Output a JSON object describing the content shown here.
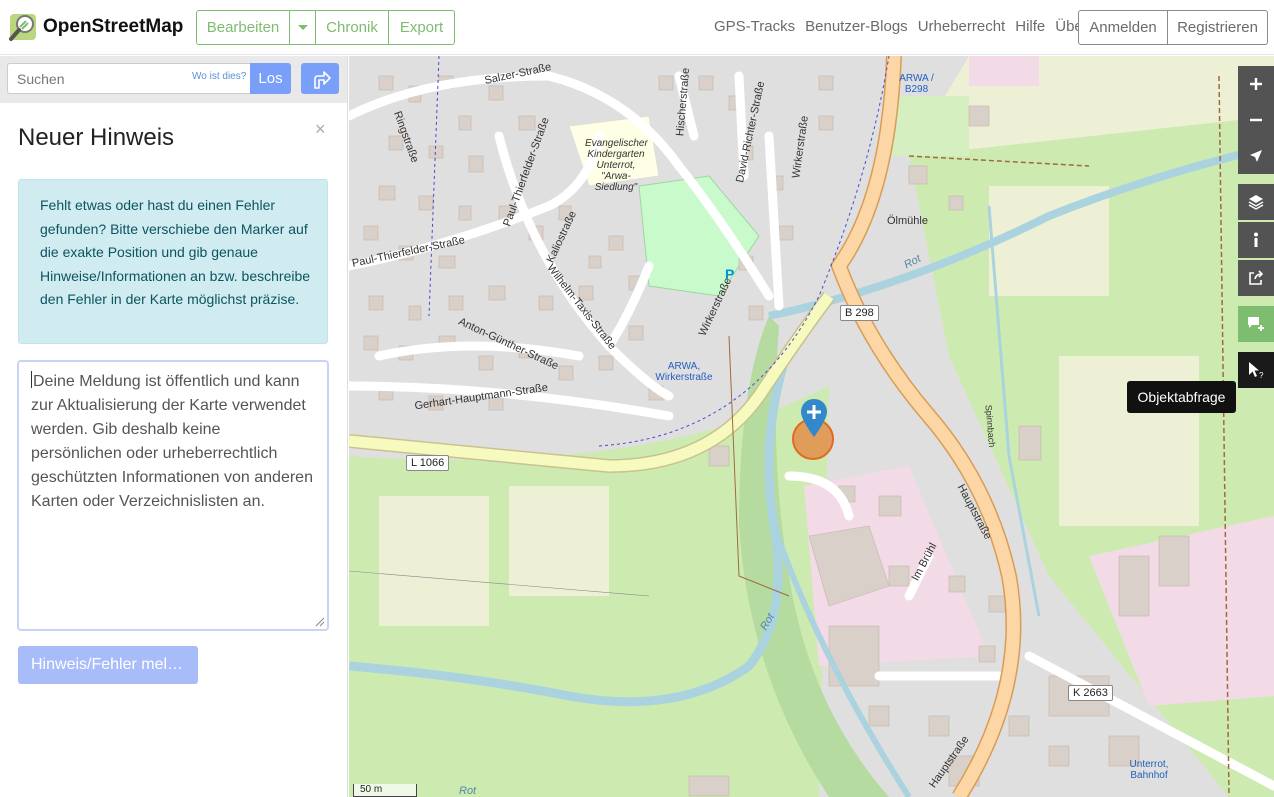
{
  "header": {
    "logo_text": "OpenStreetMap",
    "edit_label": "Bearbeiten",
    "history_label": "Chronik",
    "export_label": "Export",
    "nav": [
      "GPS-Tracks",
      "Benutzer-Blogs",
      "Urheberrecht",
      "Hilfe",
      "Über"
    ],
    "login_label": "Anmelden",
    "register_label": "Registrieren"
  },
  "search": {
    "placeholder": "Suchen",
    "where_label": "Wo ist dies?",
    "go_label": "Los"
  },
  "panel": {
    "title": "Neuer Hinweis",
    "close": "×",
    "info": "Fehlt etwas oder hast du einen Fehler gefunden? Bitte verschiebe den Marker auf die exakte Position und gib genaue Hinweise/Informationen an bzw. beschreibe den Fehler in der Karte möglichst präzise.",
    "textarea_placeholder": "Deine Meldung ist öffentlich und kann zur Aktualisierung der Karte verwendet werden. Gib deshalb keine persönlichen oder urheberrechtlich geschützten Informationen von anderen Karten oder Verzeichnislisten an.",
    "submit_label": "Hinweis/Fehler mel…"
  },
  "map": {
    "streets": [
      "Salzer-Straße",
      "Ringstraße",
      "Paul-Thierfelder-Straße",
      "Paul-Thierfelder-Straße",
      "Kaliostraße",
      "Wilhelm-Taxis-Straße",
      "Anton-Günther-Straße",
      "Gerhart-Hauptmann-Straße",
      "Hischerstraße",
      "David-Richter-Straße",
      "Wirkerstraße",
      "Wirkerstraße",
      "Hauptstraße",
      "Hauptstraße",
      "Im Brühl",
      "Spinnbach"
    ],
    "pois": {
      "kindergarten": "Evangelischer Kindergarten Unterrot, \"Arwa-Siedlung\"",
      "arwa_b298": "ARWA / B298",
      "arwa_wirkerstrasse": "ARWA, Wirkerstraße",
      "oelmuehle": "Ölmühle",
      "unterrot_bahnhof": "Unterrot, Bahnhof",
      "parking": "P"
    },
    "river_labels": [
      "Rot",
      "Rot",
      "Rot"
    ],
    "shields": [
      "B 298",
      "L 1066",
      "K 2663"
    ],
    "scale_label": "50 m",
    "tooltip": "Objektabfrage"
  },
  "colors": {
    "osm_green": "#7ebc6f",
    "search_blue": "#7a9ff9",
    "info_bg": "#d1ecf1",
    "primary_road": "#fcd6a4",
    "secondary_road": "#f7fabf",
    "water": "#aad3df",
    "grass": "#cdebb0",
    "residential": "#e0dfdf",
    "building": "#d9d0c9",
    "farmland": "#eef0d5",
    "retail": "#f2dbe6",
    "marker": "#3388cc",
    "note_circle": "#e38f4b"
  }
}
